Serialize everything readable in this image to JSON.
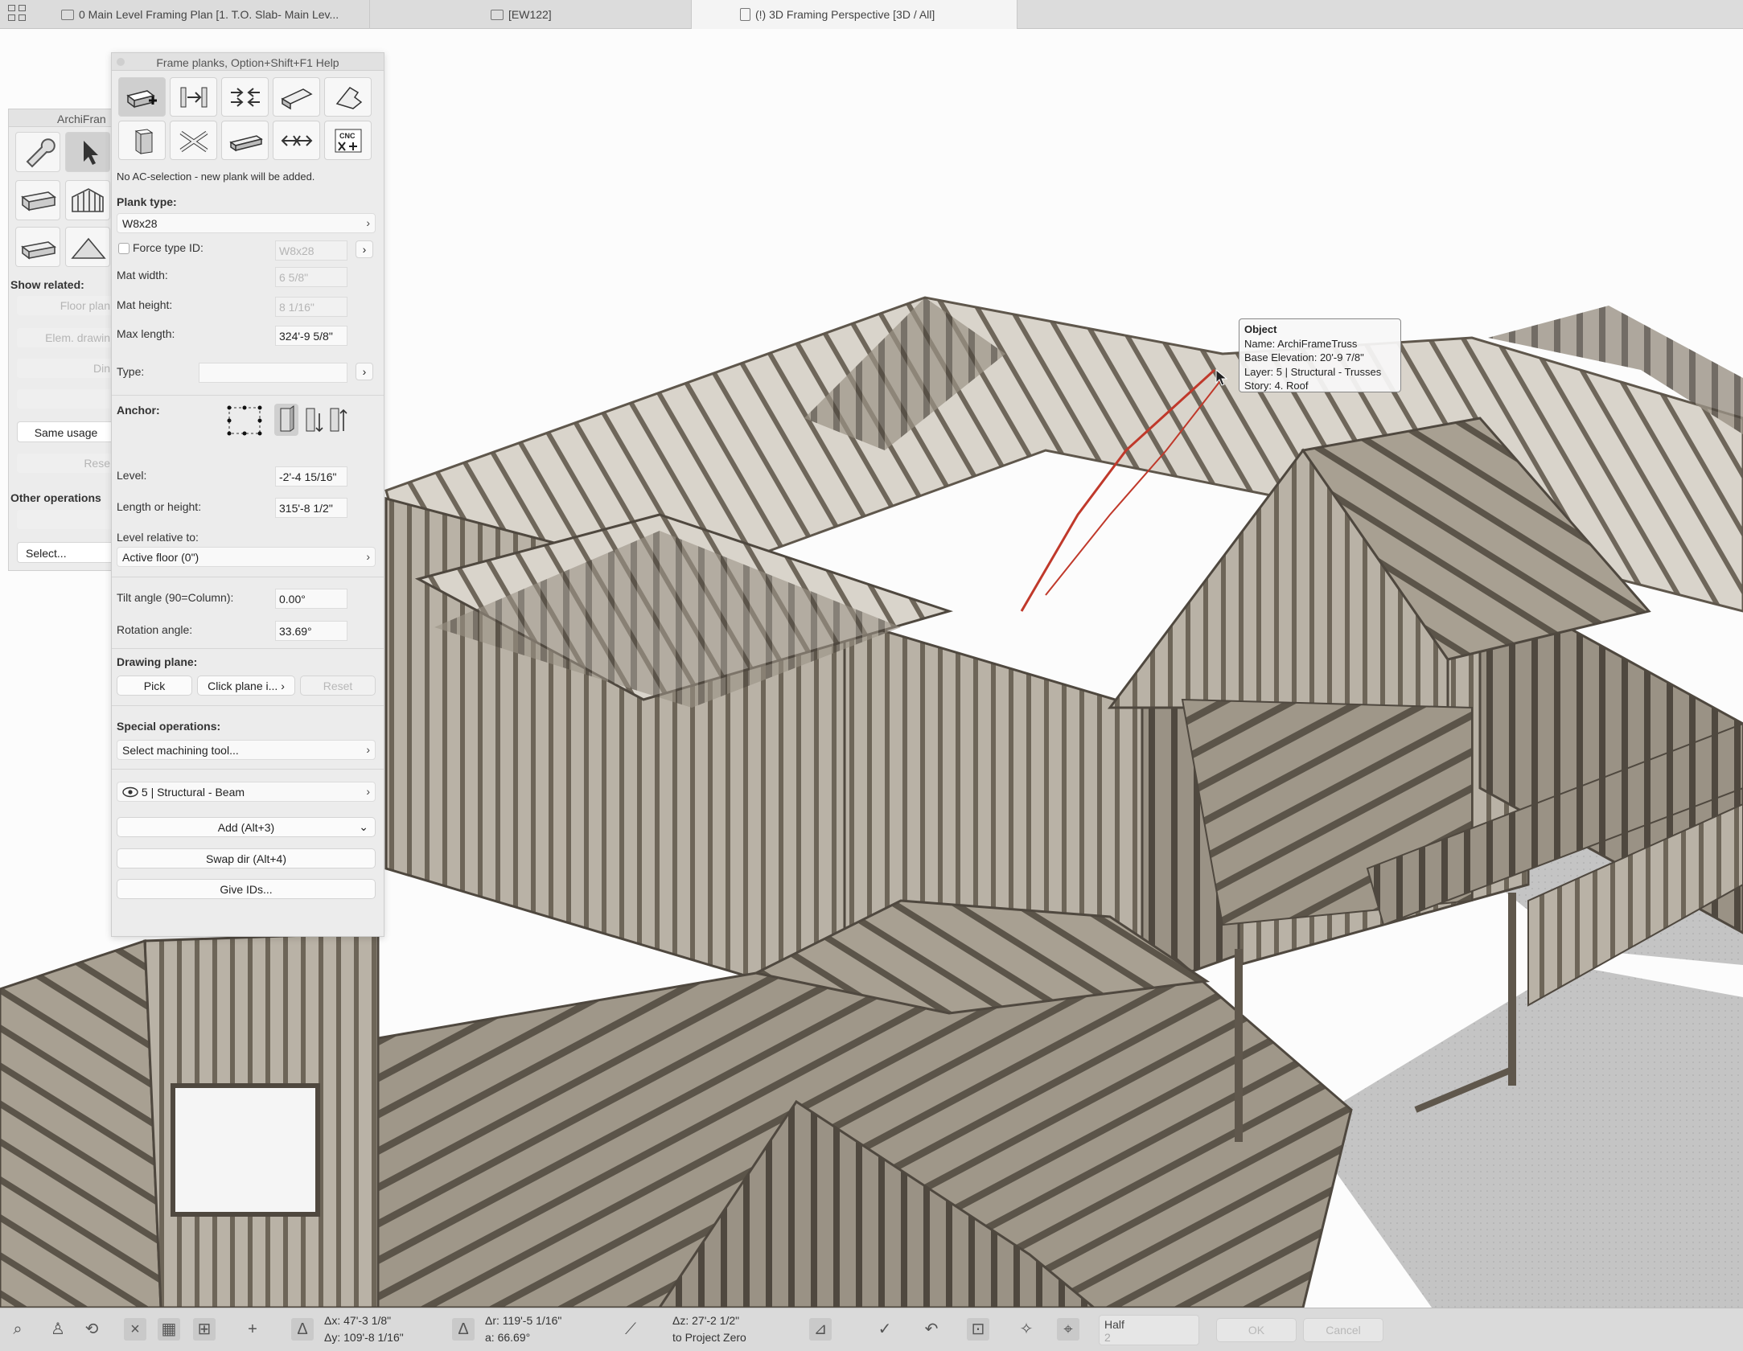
{
  "tabs": [
    {
      "label": "0 Main Level Framing Plan [1. T.O. Slab- Main Lev..."
    },
    {
      "label": "[EW122]"
    },
    {
      "label": "(!) 3D Framing Perspective [3D / All]"
    }
  ],
  "left_palette": {
    "title": "ArchiFran",
    "show_related": "Show related:",
    "floor_plan": "Floor plan",
    "elem_drawing": "Elem. drawin",
    "dim": "Din",
    "same_usage": "Same usage",
    "reset": "Rese",
    "other_operations": "Other operations",
    "select": "Select..."
  },
  "panel": {
    "title": "Frame planks, Option+Shift+F1 Help",
    "status": "No AC-selection - new plank will be added.",
    "plank_type_label": "Plank type:",
    "plank_type_value": "W8x28",
    "force_type_id_label": "Force type ID:",
    "force_type_id_value": "W8x28",
    "mat_width_label": "Mat width:",
    "mat_width_value": "6 5/8\"",
    "mat_height_label": "Mat height:",
    "mat_height_value": "8 1/16\"",
    "max_length_label": "Max length:",
    "max_length_value": "324'-9 5/8\"",
    "type_label": "Type:",
    "anchor_label": "Anchor:",
    "level_label": "Level:",
    "level_value": "-2'-4 15/16\"",
    "length_label": "Length or height:",
    "length_value": "315'-8 1/2\"",
    "level_relative_label": "Level relative to:",
    "level_relative_value": "Active floor (0\")",
    "tilt_label": "Tilt angle (90=Column):",
    "tilt_value": "0.00°",
    "rotation_label": "Rotation angle:",
    "rotation_value": "33.69°",
    "drawing_plane_label": "Drawing plane:",
    "pick": "Pick",
    "click_plane": "Click plane i...",
    "reset": "Reset",
    "special_ops_label": "Special operations:",
    "machining": "Select machining tool...",
    "layer": "5 | Structural - Beam",
    "add": "Add (Alt+3)",
    "swap": "Swap dir (Alt+4)",
    "give_ids": "Give IDs...",
    "cnc_icon_text": "CNC"
  },
  "tooltip": {
    "title": "Object",
    "name": "Name: ArchiFrameTruss",
    "base_elevation": "Base Elevation: 20'-9 7/8\"",
    "layer": "Layer: 5 | Structural - Trusses",
    "story": "Story: 4. Roof"
  },
  "statusbar": {
    "dx": "Δx: 47'-3 1/8\"",
    "dy": "Δy: 109'-8 1/16\"",
    "dr": "Δr: 119'-5 1/16\"",
    "da": "a: 66.69°",
    "dz": "Δz: 27'-2 1/2\"",
    "to_zero": "to Project Zero",
    "half": "Half",
    "half_value": "2",
    "ok": "OK",
    "cancel": "Cancel"
  },
  "colors": {
    "wood": "#8c8376",
    "wood_dark": "#5f574c",
    "floor": "#c3c3c3",
    "highlight": "#c0392b"
  }
}
